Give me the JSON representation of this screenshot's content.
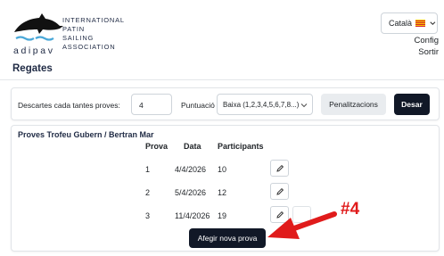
{
  "header": {
    "org_line1": "INTERNATIONAL",
    "org_line2": "PATIN",
    "org_line3": "SAILING",
    "org_line4": "ASSOCIATION",
    "brand": "adipav",
    "language": "Català",
    "config_link": "Config",
    "logout_link": "Sortir"
  },
  "page": {
    "title": "Regates"
  },
  "settings": {
    "discards_label": "Descartes cada tantes proves:",
    "discards_value": "4",
    "scoring_label": "Puntuació",
    "scoring_value": "Baixa (1,2,3,4,5,6,7,8...)",
    "penalties_button": "Penalitzacions",
    "save_button": "Desar"
  },
  "races": {
    "section_title": "Proves Trofeu Gubern / Bertran Mar",
    "columns": [
      "Prova",
      "Data",
      "Participants"
    ],
    "rows": [
      {
        "race": "1",
        "date": "4/4/2026",
        "participants": "10"
      },
      {
        "race": "2",
        "date": "5/4/2026",
        "participants": "12"
      },
      {
        "race": "3",
        "date": "11/4/2026",
        "participants": "19"
      }
    ],
    "add_button": "Afegir nova prova"
  },
  "annotation": {
    "label": "#4",
    "color": "#e01b1b"
  },
  "colors": {
    "dark_button": "#111827",
    "light_button": "#e9ecef",
    "border": "#ced4da"
  },
  "icons": [
    "dolphin-logo",
    "catalan-flag-icon",
    "chevron-down-icon",
    "pencil-icon"
  ]
}
